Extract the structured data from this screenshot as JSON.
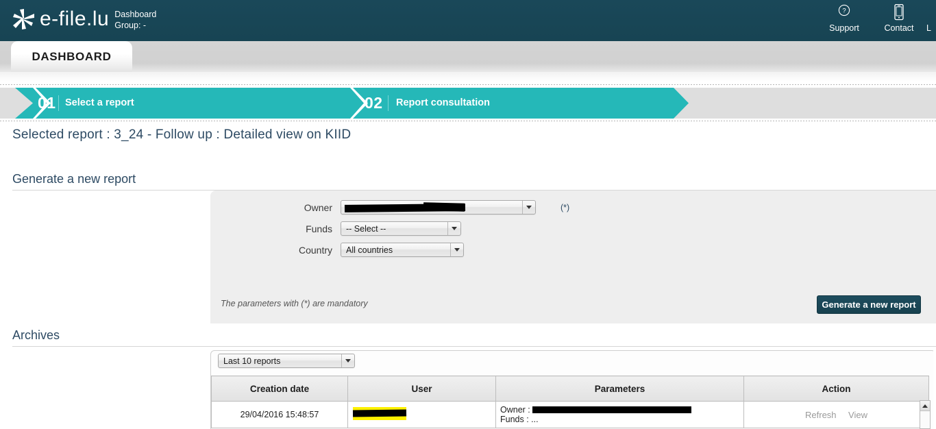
{
  "header": {
    "logo_icon": "asterisk-star-logo",
    "brand": "e-file.lu",
    "context_line1": "Dashboard",
    "context_line2": "Group: -",
    "nav": [
      {
        "label": "Support",
        "icon": "question-circle-icon"
      },
      {
        "label": "Contact",
        "icon": "mobile-phone-icon"
      }
    ],
    "nav_truncated_label": "L"
  },
  "tabs": [
    {
      "label": "DASHBOARD",
      "active": true
    }
  ],
  "steps": [
    {
      "number": "01",
      "label": "Select a report",
      "active": true
    },
    {
      "number": "02",
      "label": "Report consultation",
      "active": true
    }
  ],
  "selected_report": "Selected report : 3_24 - Follow up : Detailed view on KIID",
  "generate_section": {
    "title": "Generate a new report",
    "fields": [
      {
        "label": "Owner",
        "value": "",
        "mandatory": "(*)",
        "redacted": true
      },
      {
        "label": "Funds",
        "value": "-- Select --",
        "mandatory": "",
        "redacted": false
      },
      {
        "label": "Country",
        "value": "All countries",
        "mandatory": "",
        "redacted": false
      }
    ],
    "note": "The parameters with (*) are mandatory",
    "submit_label": "Generate a new report"
  },
  "archives_section": {
    "title": "Archives",
    "filter_value": "Last 10 reports",
    "columns": [
      "Creation date",
      "User",
      "Parameters",
      "Action"
    ],
    "rows": [
      {
        "creation_date": "29/04/2016 15:48:57",
        "user": "",
        "parameters_owner_label": "Owner :",
        "parameters_owner_value": "",
        "parameters_funds_label": "Funds :",
        "parameters_funds_value": "...",
        "actions": [
          "Refresh",
          "View"
        ]
      }
    ]
  },
  "colors": {
    "header_bg": "#1b4a5a",
    "step_teal": "#25b8b8",
    "accent_text": "#2d4a63",
    "panel_bg": "#eeeeee",
    "highlight_yellow": "#fff100",
    "redaction_black": "#000000"
  }
}
